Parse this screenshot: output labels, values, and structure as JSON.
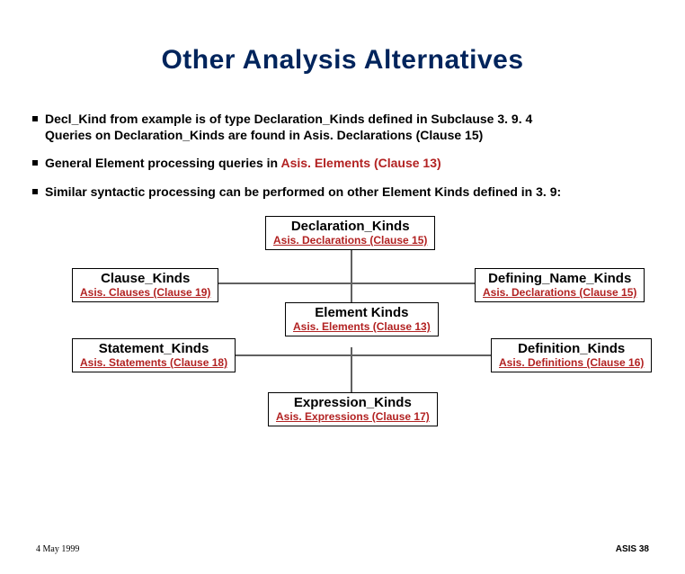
{
  "title": "Other Analysis Alternatives",
  "bullets": [
    {
      "text": "Decl_Kind from example is of type Declaration_Kinds defined in Subclause 3. 9. 4\nQueries on Declaration_Kinds are found in Asis. Declarations (Clause 15)",
      "asis_ranges": []
    },
    {
      "prefix": "General Element processing queries in ",
      "asis": "Asis. Elements (Clause 13)"
    },
    {
      "text": "Similar syntactic processing can be performed on other Element Kinds defined in 3. 9:"
    }
  ],
  "nodes": {
    "declaration": {
      "title": "Declaration_Kinds",
      "sub": "Asis. Declarations (Clause 15)"
    },
    "clause": {
      "title": "Clause_Kinds",
      "sub": "Asis. Clauses (Clause 19)"
    },
    "defining": {
      "title": "Defining_Name_Kinds",
      "sub": "Asis. Declarations (Clause 15)"
    },
    "element": {
      "title": "Element Kinds",
      "sub": "Asis. Elements (Clause 13)"
    },
    "statement": {
      "title": "Statement_Kinds",
      "sub": "Asis. Statements (Clause 18)"
    },
    "definition": {
      "title": "Definition_Kinds",
      "sub": "Asis. Definitions (Clause 16)"
    },
    "expression": {
      "title": "Expression_Kinds",
      "sub": "Asis. Expressions (Clause 17)"
    }
  },
  "footer": {
    "left": "4 May 1999",
    "right": "ASIS 38"
  }
}
